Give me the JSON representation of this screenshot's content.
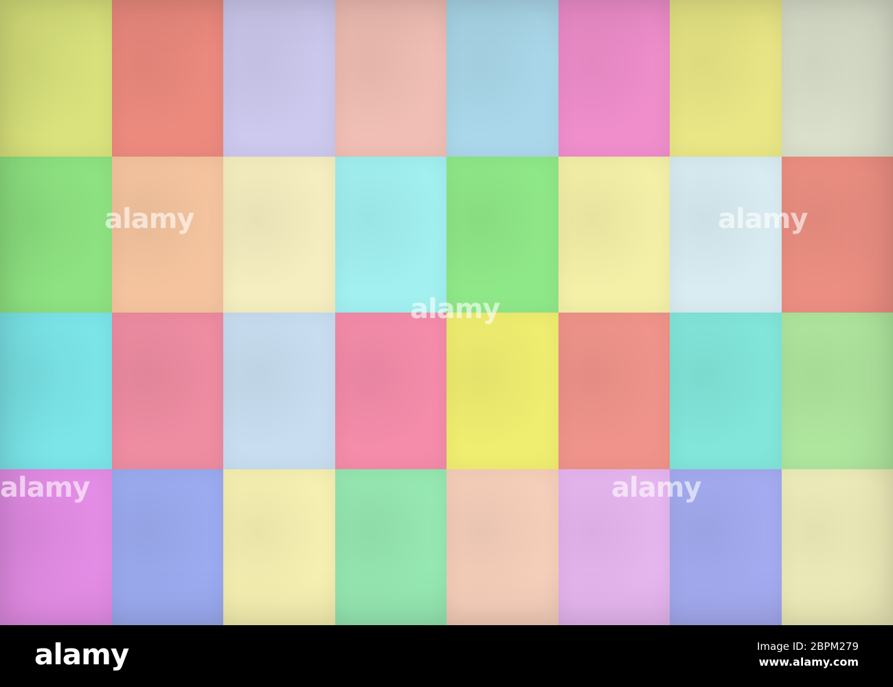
{
  "tiles": [
    [
      "#d9e27c",
      "#ec8a7e",
      "#cdc9ee",
      "#f0beb4",
      "#aad8ea",
      "#ef8ecb",
      "#e8e685",
      "#d9dfca"
    ],
    [
      "#8ee281",
      "#f5c49f",
      "#f4eec0",
      "#a2f0f0",
      "#8fe888",
      "#f4f0a8",
      "#d8ecf2",
      "#ec8f82"
    ],
    [
      "#7be5e8",
      "#ee8ca2",
      "#c8def0",
      "#f48caa",
      "#f0ee70",
      "#f0948b",
      "#82e6da",
      "#afe69e"
    ],
    [
      "#e48de6",
      "#9cabf0",
      "#f6f0b2",
      "#96e8b2",
      "#f6cfba",
      "#e6b6ef",
      "#a4abf0",
      "#efedba"
    ]
  ],
  "watermark": "alamy",
  "footer": {
    "logo": "alamy",
    "image_id": "Image ID: 2BPM279",
    "site": "www.alamy.com"
  }
}
